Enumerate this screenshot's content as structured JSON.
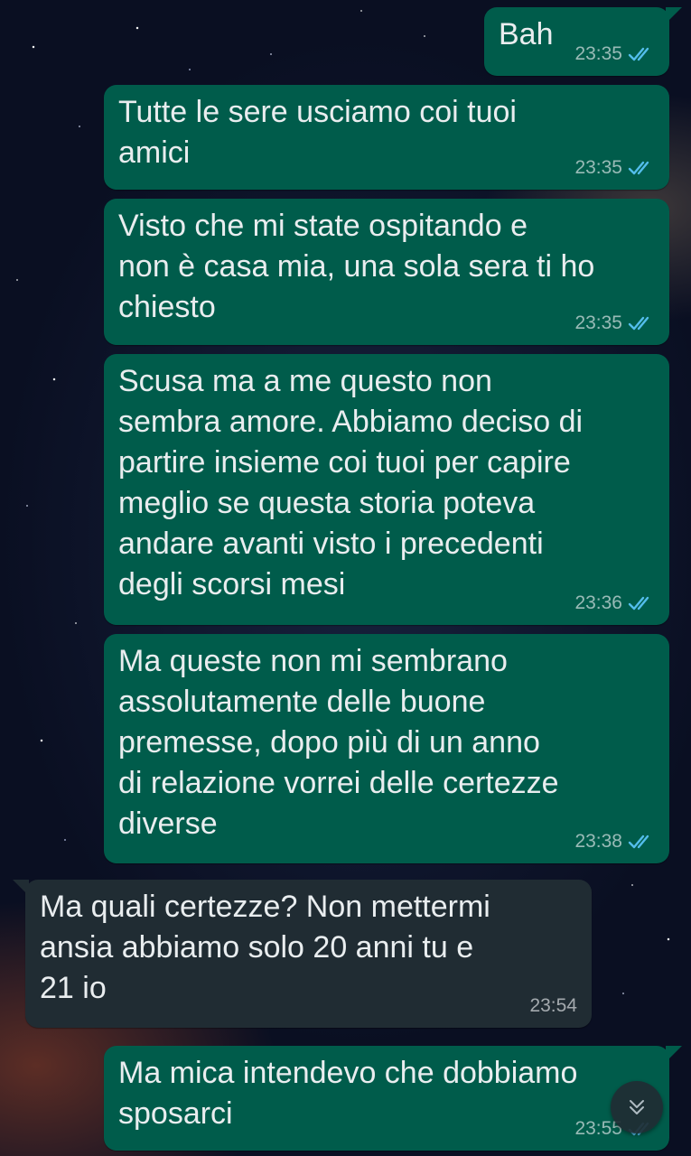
{
  "conversation": {
    "messages": [
      {
        "direction": "sent",
        "text": "Bah",
        "time": "23:35",
        "status": "read"
      },
      {
        "direction": "sent",
        "text": "Tutte le sere usciamo coi tuoi\namici",
        "time": "23:35",
        "status": "read"
      },
      {
        "direction": "sent",
        "text": "Visto che mi state ospitando e\nnon è casa mia, una sola sera ti ho\nchiesto",
        "time": "23:35",
        "status": "read"
      },
      {
        "direction": "sent",
        "text": "Scusa ma a me questo non\nsembra amore. Abbiamo deciso di\npartire insieme coi tuoi per capire\nmeglio se questa storia poteva\nandare avanti visto i precedenti\ndegli scorsi mesi",
        "time": "23:36",
        "status": "read"
      },
      {
        "direction": "sent",
        "text": "Ma queste non mi sembrano\nassolutamente delle buone\npremesse, dopo più di un anno\ndi relazione vorrei delle certezze\ndiverse",
        "time": "23:38",
        "status": "read"
      },
      {
        "direction": "received",
        "text": "Ma quali certezze? Non mettermi\nansia abbiamo solo 20 anni tu e\n21 io",
        "time": "23:54"
      },
      {
        "direction": "sent",
        "text": "Ma mica intendevo che dobbiamo\nsposarci",
        "time": "23:55",
        "status": "read"
      }
    ]
  },
  "icons": {
    "read_receipt": "double-check-icon",
    "scroll_down": "chevron-down-icon"
  },
  "colors": {
    "sent_bubble": "#005c4b",
    "received_bubble": "#202c33",
    "text": "#e9edef",
    "read_tick": "#53bdeb"
  }
}
